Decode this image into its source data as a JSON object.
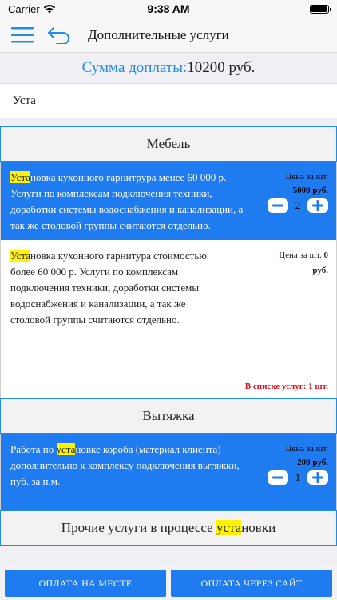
{
  "status_bar": {
    "carrier": "Carrier",
    "time": "9:38 AM"
  },
  "nav": {
    "title": "Дополнительные услуги"
  },
  "sum": {
    "label": "Сумма доплаты:",
    "value": "10200 руб."
  },
  "search": {
    "value": "Уста"
  },
  "sections": [
    {
      "title": "Мебель",
      "items": [
        {
          "highlight": "Уста",
          "rest": "новка кухонного гарнитрура менее 60 000 р. Услуги по комплексам подключения техники, доработки системы водоснабжения и канализации, а так же столовой группы считаются отдельно.",
          "price_label": "Цена за шт.",
          "price_value": "5000 руб.",
          "qty": "2"
        },
        {
          "highlight": "Уста",
          "rest": "новка кухонного гарнитура стоимостью более 60 000 р. Услуги по комплексам подключения техники, доработки системы водоснабжения и канализации, а так же столовой группы считаются отдельно.",
          "price_label": "Цена за шт.",
          "price_num": "0",
          "price_unit": "руб.",
          "in_list": "В списке услуг: 1 шт."
        }
      ]
    },
    {
      "title": "Вытяжка",
      "items": [
        {
          "prefix": "Работа по ",
          "highlight": "уста",
          "rest": "новке короба (материал клиента) дополнительно к комплексу подключения вытяжки, пуб. за п.м.",
          "price_label": "Цена за шт.",
          "price_value": "200 руб.",
          "qty": "1"
        }
      ]
    },
    {
      "title_prefix": "Прочие услуги в процессе ",
      "title_highlight": "уста",
      "title_rest": "новки"
    }
  ],
  "bottom": {
    "pay_onsite": "ОПЛАТА НА МЕСТЕ",
    "pay_site": "ОПЛАТА ЧЕРЕЗ САЙТ"
  },
  "colors": {
    "accent": "#1e7bf0",
    "highlight": "#fff200",
    "warning": "#d8141f"
  }
}
